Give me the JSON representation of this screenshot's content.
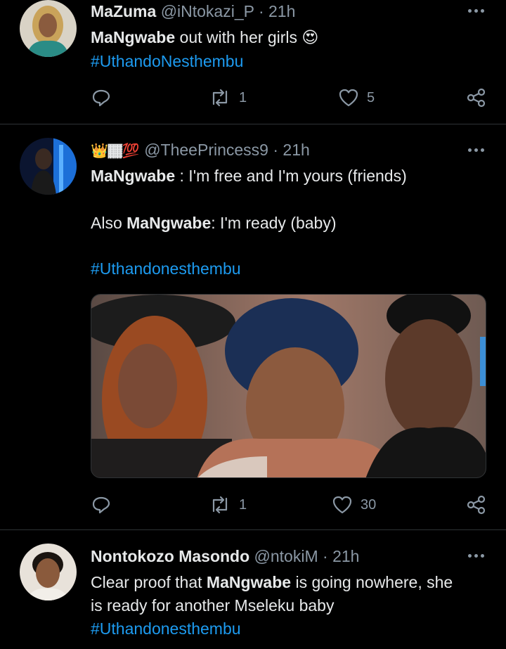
{
  "tweets": [
    {
      "name": "MaZuma",
      "handle": "@iNtokazi_P",
      "time": "21h",
      "body_lines": [
        {
          "bold": "MaNgwabe",
          "rest": " out with her girls",
          "emoji": "😍"
        }
      ],
      "hashtag": "#UthandoNesthembu",
      "retweets": "1",
      "likes": "5"
    },
    {
      "name_emoji": "👑🏾💯",
      "handle": "@TheePrincess9",
      "time": "21h",
      "line1_bold": "MaNgwabe",
      "line1_rest": " : I'm free and I'm yours (friends)",
      "line2_pre": "Also ",
      "line2_bold": "MaNgwabe",
      "line2_rest": ": I'm  ready (baby)",
      "hashtag": "#Uthandonesthembu",
      "retweets": "1",
      "likes": "30"
    },
    {
      "name": "Nontokozo Masondo",
      "handle": "@ntokiM",
      "time": "21h",
      "line1_pre": "Clear proof that ",
      "line1_bold": "MaNgwabe",
      "line1_rest": " is going nowhere, she",
      "line2": "is ready for another Mseleku baby",
      "hashtag": "#Uthandonesthembu"
    }
  ],
  "colors": {
    "accent": "#1d9bf0",
    "muted": "#8b98a5",
    "divider": "#2f3336",
    "background": "#000000"
  }
}
